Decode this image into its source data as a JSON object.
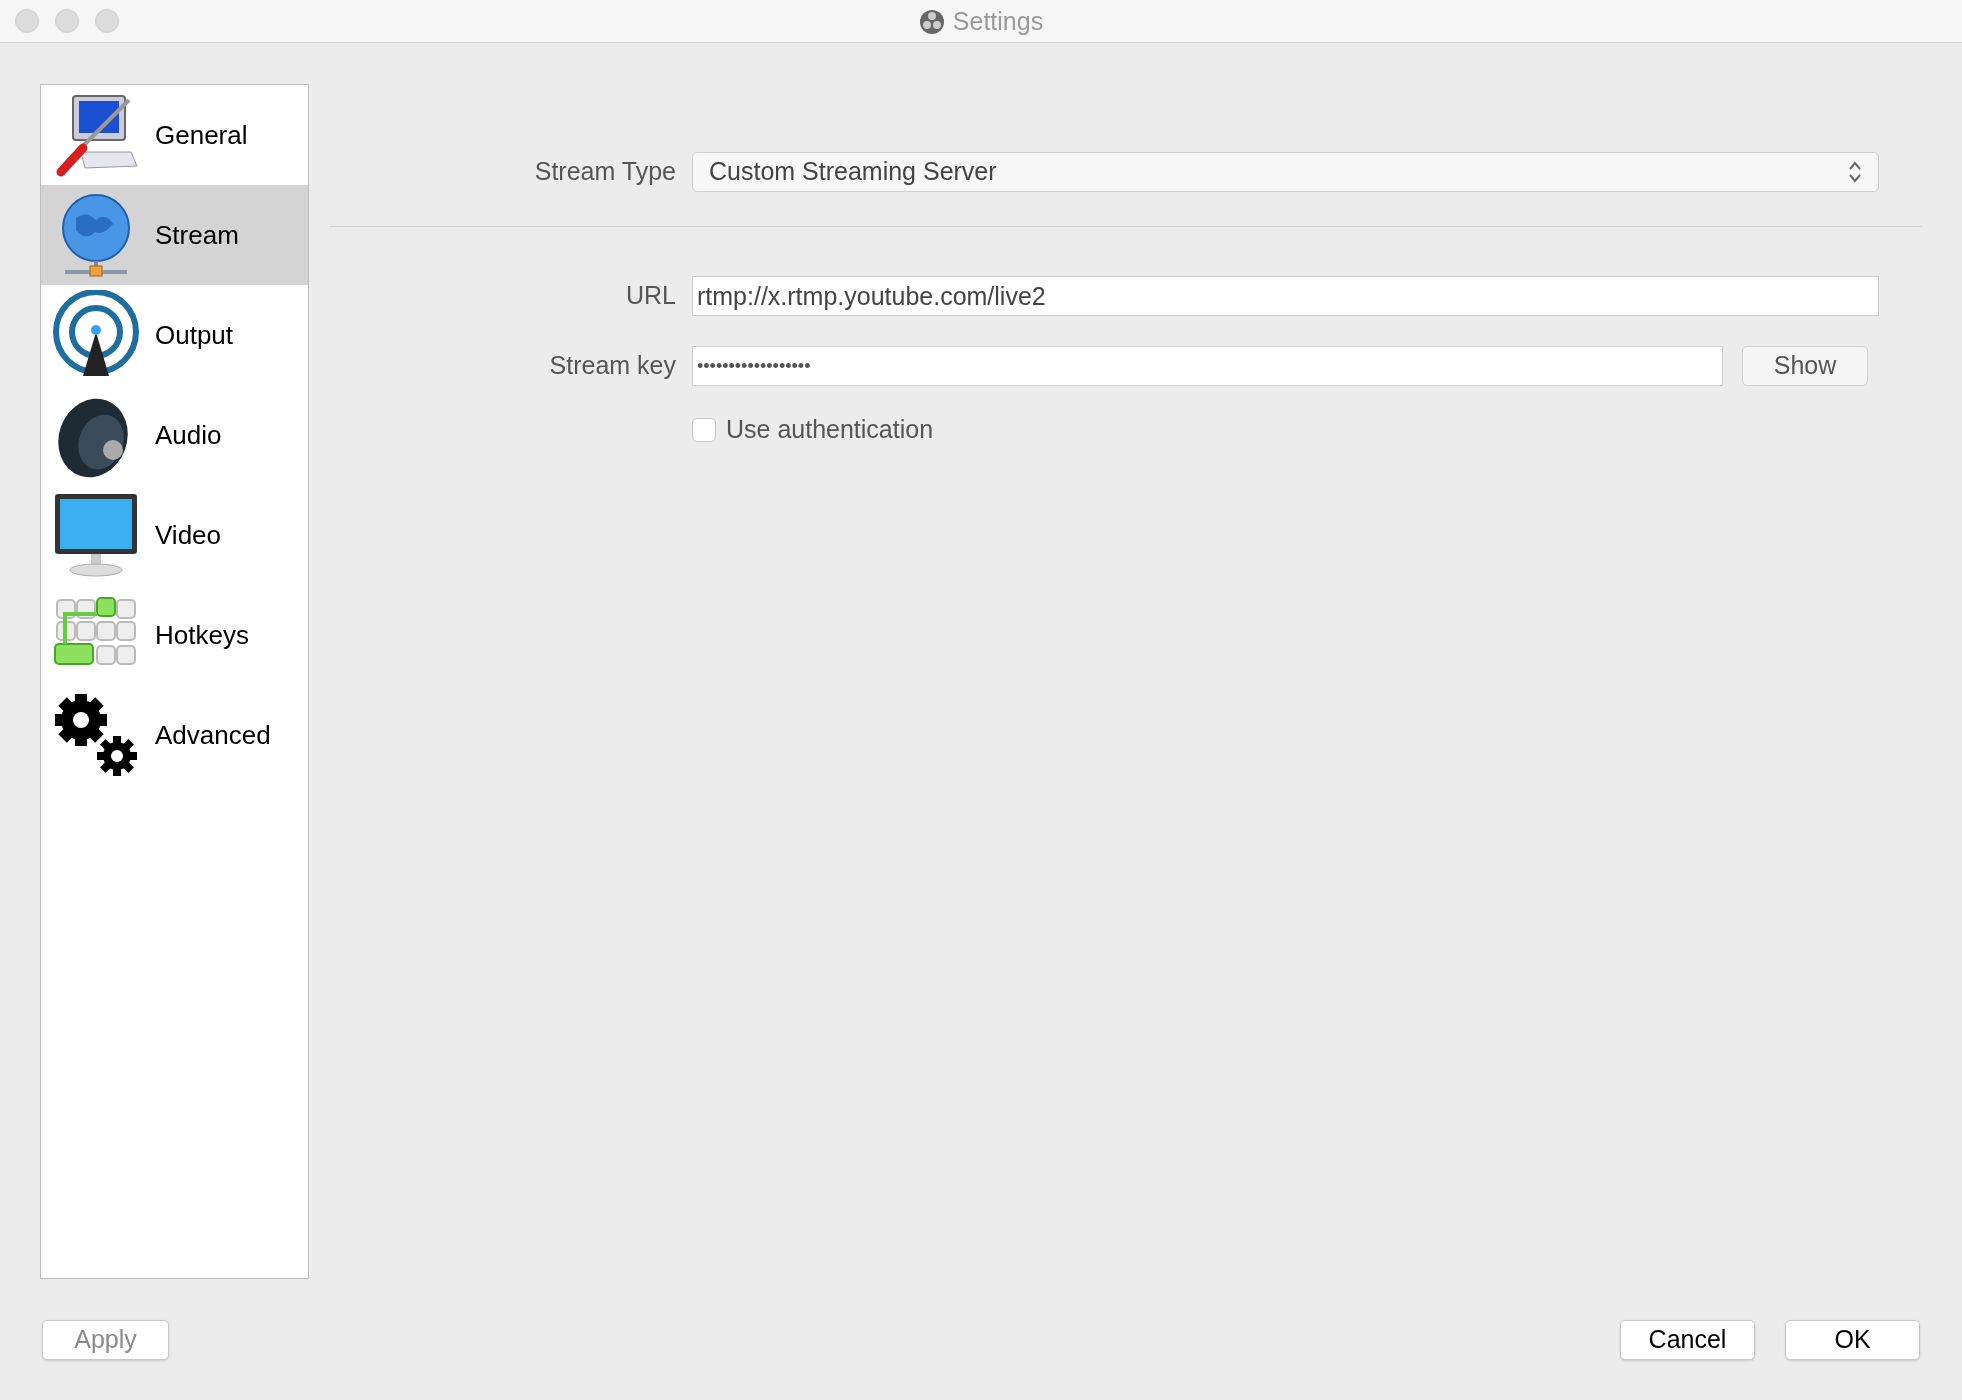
{
  "window": {
    "title": "Settings"
  },
  "sidebar": {
    "items": [
      {
        "label": "General",
        "kind": "general",
        "selected": false
      },
      {
        "label": "Stream",
        "kind": "stream",
        "selected": true
      },
      {
        "label": "Output",
        "kind": "output",
        "selected": false
      },
      {
        "label": "Audio",
        "kind": "audio",
        "selected": false
      },
      {
        "label": "Video",
        "kind": "video",
        "selected": false
      },
      {
        "label": "Hotkeys",
        "kind": "hotkeys",
        "selected": false
      },
      {
        "label": "Advanced",
        "kind": "advanced",
        "selected": false
      }
    ]
  },
  "stream_type": {
    "label": "Stream Type",
    "value": "Custom Streaming Server"
  },
  "url": {
    "label": "URL",
    "value": "rtmp://x.rtmp.youtube.com/live2"
  },
  "stream_key": {
    "label": "Stream key",
    "value": "••••••••••••••••••",
    "button": "Show"
  },
  "use_authentication": {
    "label": "Use authentication",
    "checked": false
  },
  "footer": {
    "left": [
      {
        "label": "Apply",
        "disabled": true
      }
    ],
    "right": [
      {
        "label": "Cancel",
        "disabled": false
      },
      {
        "label": "OK",
        "disabled": false
      }
    ]
  }
}
